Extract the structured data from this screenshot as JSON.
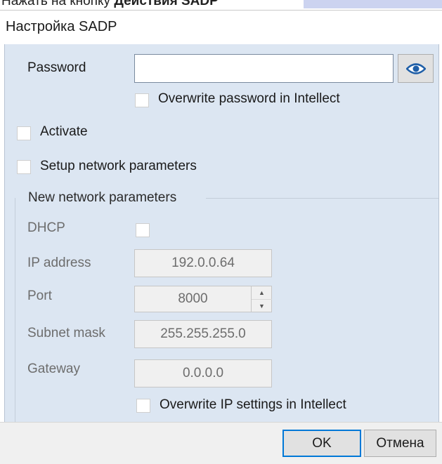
{
  "caption": {
    "prefix": "Нажать на кнопку ",
    "bold": "Действия SADP"
  },
  "window": {
    "title": "Настройка SADP"
  },
  "auth": {
    "password_label": "Password",
    "password_value": "",
    "show_password_icon": "eye-icon",
    "overwrite_password_label": "Overwrite password in Intellect",
    "overwrite_password_checked": false
  },
  "activate": {
    "label": "Activate",
    "checked": false
  },
  "setup_network": {
    "label": "Setup network parameters",
    "checked": false
  },
  "network": {
    "group_label": "New network parameters",
    "dhcp_label": "DHCP",
    "dhcp_checked": false,
    "ip_label": "IP address",
    "ip_value": "192.0.0.64",
    "port_label": "Port",
    "port_value": "8000",
    "subnet_label": "Subnet mask",
    "subnet_value": "255.255.255.0",
    "gateway_label": "Gateway",
    "gateway_value": "0.0.0.0",
    "overwrite_ip_label": "Overwrite IP settings in Intellect",
    "overwrite_ip_checked": false
  },
  "buttons": {
    "ok": "OK",
    "cancel": "Отмена"
  },
  "colors": {
    "body_background": "#dce6f2",
    "accent": "#0078d7",
    "disabled_text": "#6d6d6d"
  }
}
